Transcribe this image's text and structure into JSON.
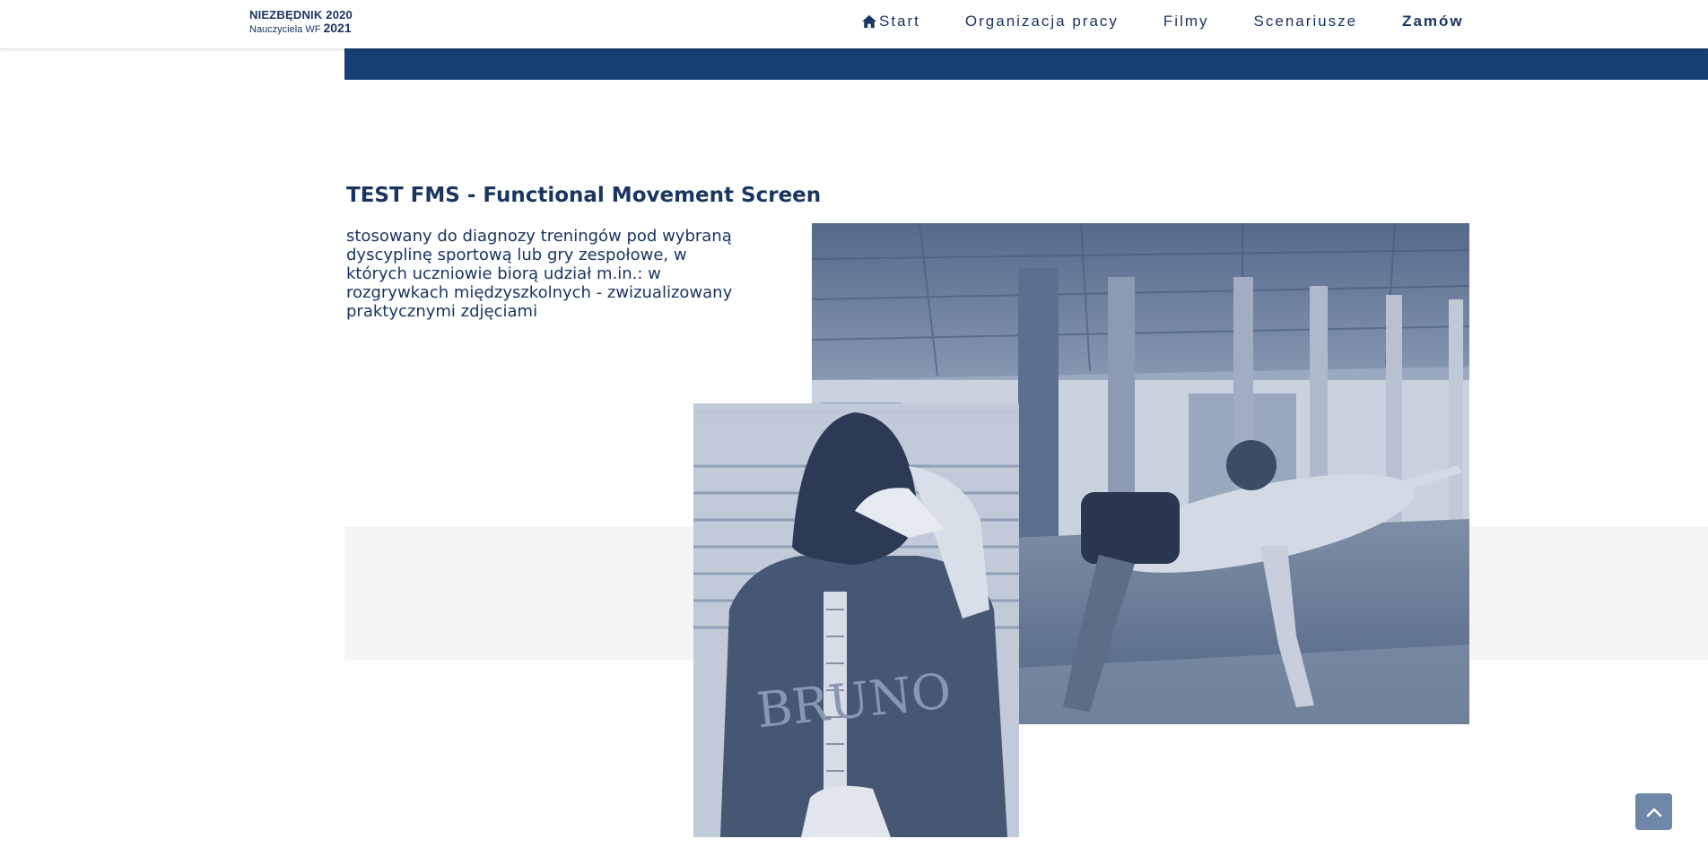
{
  "brand": {
    "line1": "NIEZBĘDNIK 2020",
    "line2_sub": "Nauczyciela WF",
    "line2_year": "2021"
  },
  "nav": {
    "items": [
      {
        "label": "Start",
        "icon": "home-icon"
      },
      {
        "label": "Organizacja pracy"
      },
      {
        "label": "Filmy"
      },
      {
        "label": "Scenariusze"
      },
      {
        "label": "Zamów",
        "emphasis": "bold"
      }
    ]
  },
  "section": {
    "title_strong": "TEST FMS",
    "title_rest": " - Functional Movement Screen",
    "description": "stosowany do diagnozy treningów pod wybraną dyscyplinę sportową lub gry zespołowe, w których uczniowie biorą udział m.in.: w rozgrywkach międzyszkolnych - zwizualizowany praktycznymi zdjęciami"
  },
  "images": {
    "large": {
      "icon": "fms-exercise-photo"
    },
    "small": {
      "icon": "fms-shoulder-test-photo",
      "jersey_text": "BRUNO"
    }
  },
  "scroll_top": {
    "icon": "chevron-up-icon"
  },
  "colors": {
    "brand_navy": "#1b3561",
    "band_blue": "#163f74",
    "band_gray": "#f5f5f5",
    "scroll_button": "#6f87a8"
  }
}
